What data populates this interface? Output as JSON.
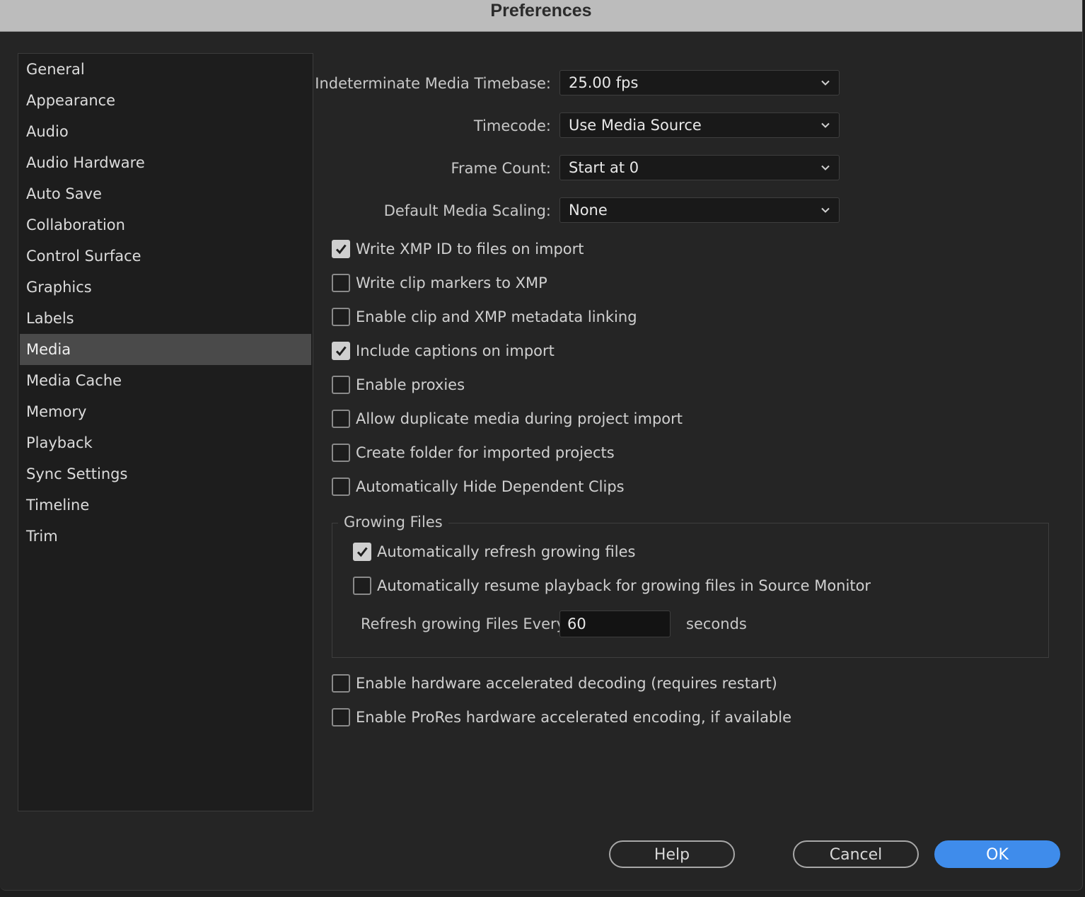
{
  "window": {
    "title": "Preferences"
  },
  "sidebar": {
    "items": [
      {
        "label": "General"
      },
      {
        "label": "Appearance"
      },
      {
        "label": "Audio"
      },
      {
        "label": "Audio Hardware"
      },
      {
        "label": "Auto Save"
      },
      {
        "label": "Collaboration"
      },
      {
        "label": "Control Surface"
      },
      {
        "label": "Graphics"
      },
      {
        "label": "Labels"
      },
      {
        "label": "Media",
        "selected": true
      },
      {
        "label": "Media Cache"
      },
      {
        "label": "Memory"
      },
      {
        "label": "Playback"
      },
      {
        "label": "Sync Settings"
      },
      {
        "label": "Timeline"
      },
      {
        "label": "Trim"
      }
    ]
  },
  "media": {
    "timebase": {
      "label": "Indeterminate Media Timebase:",
      "value": "25.00 fps"
    },
    "timecode": {
      "label": "Timecode:",
      "value": "Use Media Source"
    },
    "frame_count": {
      "label": "Frame Count:",
      "value": "Start at 0"
    },
    "scaling": {
      "label": "Default Media Scaling:",
      "value": "None"
    },
    "checkboxes": [
      {
        "label": "Write XMP ID to files on import",
        "checked": true
      },
      {
        "label": "Write clip markers to XMP",
        "checked": false
      },
      {
        "label": "Enable clip and XMP metadata linking",
        "checked": false
      },
      {
        "label": "Include captions on import",
        "checked": true
      },
      {
        "label": "Enable proxies",
        "checked": false
      },
      {
        "label": "Allow duplicate media during project import",
        "checked": false
      },
      {
        "label": "Create folder for imported projects",
        "checked": false
      },
      {
        "label": "Automatically Hide Dependent Clips",
        "checked": false
      }
    ],
    "growing_files": {
      "title": "Growing Files",
      "auto_refresh": {
        "label": "Automatically refresh growing files",
        "checked": true
      },
      "auto_resume": {
        "label": "Automatically resume playback for growing files in Source Monitor",
        "checked": false
      },
      "refresh_label": "Refresh growing Files Every",
      "refresh_value": "60",
      "refresh_unit": "seconds"
    },
    "hw_decoding": {
      "label": "Enable hardware accelerated decoding (requires restart)",
      "checked": false
    },
    "prores_encoding": {
      "label": "Enable ProRes hardware accelerated encoding, if available",
      "checked": false
    }
  },
  "buttons": {
    "help": "Help",
    "cancel": "Cancel",
    "ok": "OK"
  },
  "colors": {
    "accent": "#3f8ceb",
    "selected_item": "#4a4a4a",
    "background": "#252525"
  }
}
